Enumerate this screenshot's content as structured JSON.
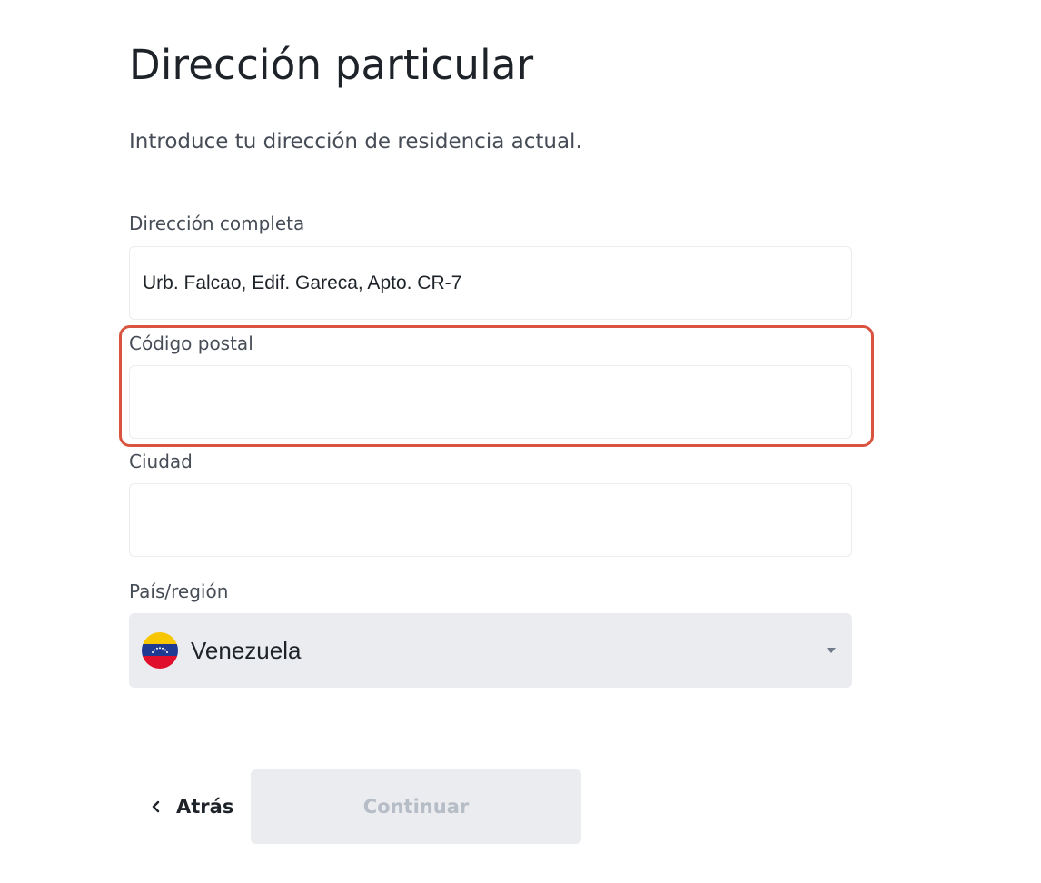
{
  "page": {
    "title": "Dirección particular",
    "subtitle": "Introduce tu dirección de residencia actual."
  },
  "form": {
    "address": {
      "label": "Dirección completa",
      "value": "Urb. Falcao, Edif. Gareca, Apto. CR-7",
      "placeholder": ""
    },
    "postal_code": {
      "label": "Código postal",
      "value": "",
      "placeholder": ""
    },
    "city": {
      "label": "Ciudad",
      "value": "",
      "placeholder": ""
    },
    "country": {
      "label": "País/región",
      "selected": "Venezuela",
      "flag_icon": "venezuela-flag-icon",
      "dropdown_icon": "caret-down-icon"
    }
  },
  "actions": {
    "back_label": "Atrás",
    "back_icon": "chevron-left-icon",
    "continue_label": "Continuar"
  },
  "colors": {
    "highlight": "#d9533f",
    "disabled_button_bg": "#eaecef",
    "disabled_button_text": "#b7bdc6",
    "flag_yellow": "#f7c600",
    "flag_blue": "#1f3a93",
    "flag_red": "#e0102d"
  }
}
